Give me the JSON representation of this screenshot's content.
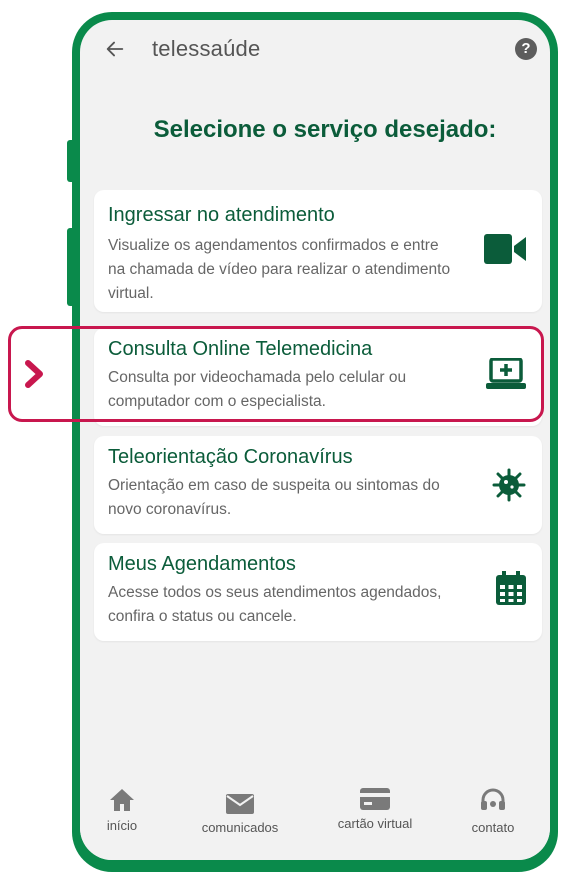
{
  "header": {
    "title": "telessaúde",
    "back_icon": "arrow-left-icon",
    "help_icon": "question-circle-icon",
    "help_glyph": "?"
  },
  "heading": "Selecione o serviço desejado:",
  "cards": [
    {
      "title": "Ingressar no atendimento",
      "description": "Visualize os agendamentos confirmados e entre na chamada de vídeo para realizar o atendimento virtual.",
      "icon": "video-camera-icon"
    },
    {
      "title": "Consulta Online Telemedicina",
      "description": "Consulta por videochamada pelo celular ou computador com o especialista.",
      "icon": "laptop-medical-icon"
    },
    {
      "title": "Teleorientação Coronavírus",
      "description": "Orientação em caso de suspeita ou sintomas do novo coronavírus.",
      "icon": "virus-icon"
    },
    {
      "title": "Meus Agendamentos",
      "description": "Acesse todos os seus atendimentos agendados, confira o status ou cancele.",
      "icon": "calendar-icon"
    }
  ],
  "bottom_nav": [
    {
      "label": "início",
      "icon": "home-icon"
    },
    {
      "label": "comunicados",
      "icon": "envelope-icon"
    },
    {
      "label": "cartão virtual",
      "icon": "credit-card-icon"
    },
    {
      "label": "contato",
      "icon": "headset-icon"
    }
  ],
  "colors": {
    "brand_green": "#0a8a4b",
    "text_green": "#0b5c3a",
    "highlight": "#c8174e"
  }
}
